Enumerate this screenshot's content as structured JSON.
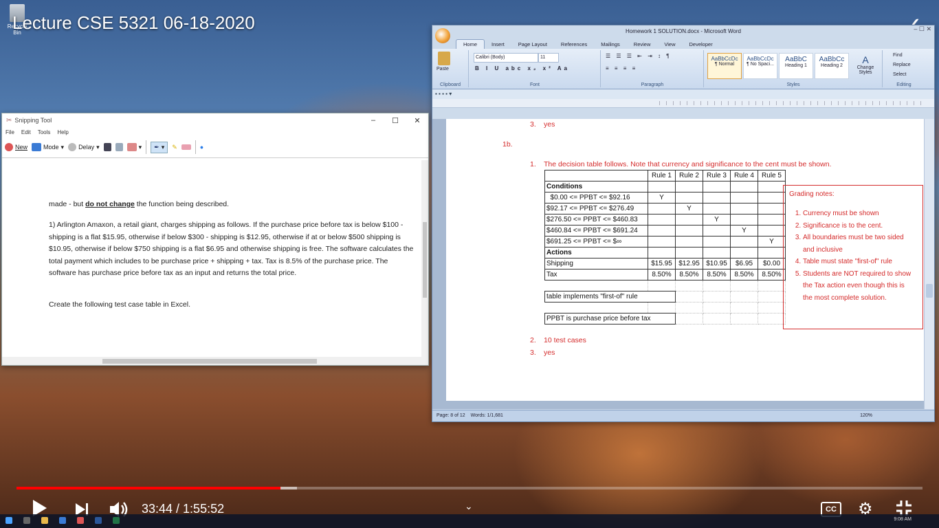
{
  "video": {
    "title": "Lecture CSE 5321 06-18-2020",
    "time": "33:44 / 1:55:52",
    "progress_fraction": 0.2913,
    "cc_label": "CC"
  },
  "desktop": {
    "recycle_label": "Recycle Bin"
  },
  "snip": {
    "title": "Snipping Tool",
    "menu": [
      "File",
      "Edit",
      "Tools",
      "Help"
    ],
    "new_label": "New",
    "mode_label": "Mode",
    "delay_label": "Delay",
    "para0_pre": "made - but ",
    "para0_bold": "do not change",
    "para0_post": " the function being described.",
    "para1": "1)  Arlington Amaxon, a retail giant, charges shipping as follows. If the purchase price before tax is below $100 - shipping is a flat $15.95, otherwise if below $300 - shipping is $12.95, otherwise if at or below $500 shipping is $10.95, otherwise if below $750 shipping is a flat $6.95 and otherwise shipping is free. The software calculates the total payment which includes to be purchase price + shipping + tax. Tax is 8.5% of the purchase price. The software has purchase price before tax as an input and returns the total price.",
    "para2": "Create the following test case table in Excel."
  },
  "word": {
    "title": "Homework 1 SOLUTION.docx - Microsoft Word",
    "tabs": [
      "Home",
      "Insert",
      "Page Layout",
      "References",
      "Mailings",
      "Review",
      "View",
      "Developer"
    ],
    "font_name": "Calibri (Body)",
    "font_size": "11",
    "paste_label": "Paste",
    "groups": [
      "Clipboard",
      "Font",
      "Paragraph",
      "Styles",
      "Editing"
    ],
    "styles": [
      {
        "sample": "AaBbCcDc",
        "name": "¶ Normal"
      },
      {
        "sample": "AaBbCcDc",
        "name": "¶ No Spaci..."
      },
      {
        "sample": "AaBbC",
        "name": "Heading 1"
      },
      {
        "sample": "AaBbCc",
        "name": "Heading 2"
      }
    ],
    "change_styles": "Change Styles",
    "editing": [
      "Find",
      "Replace",
      "Select"
    ],
    "status_page": "Page: 8 of 12",
    "status_words": "Words: 1/1,681",
    "zoom": "120%",
    "doc": {
      "item3a_num": "3.",
      "item3a_text": "yes",
      "section": "1b.",
      "item1_num": "1.",
      "item1_text": "The decision table follows. Note that currency and significance to the cent must be shown.",
      "rule_headers": [
        "Rule 1",
        "Rule 2",
        "Rule 3",
        "Rule 4",
        "Rule 5"
      ],
      "conditions_label": "Conditions",
      "conditions": [
        {
          "label": "  $0.00 <= PPBT <= $92.16",
          "marks": [
            "Y",
            "",
            "",
            "",
            ""
          ]
        },
        {
          "label": "$92.17 <= PPBT <= $276.49",
          "marks": [
            "",
            "Y",
            "",
            "",
            ""
          ]
        },
        {
          "label": "$276.50 <= PPBT <= $460.83",
          "marks": [
            "",
            "",
            "Y",
            "",
            ""
          ]
        },
        {
          "label": "$460.84 <= PPBT <= $691.24",
          "marks": [
            "",
            "",
            "",
            "Y",
            ""
          ]
        },
        {
          "label": "$691.25 <= PPBT <= $∞",
          "marks": [
            "",
            "",
            "",
            "",
            "Y"
          ]
        }
      ],
      "actions_label": "Actions",
      "actions": [
        {
          "label": "Shipping",
          "values": [
            "$15.95",
            "$12.95",
            "$10.95",
            "$6.95",
            "$0.00"
          ]
        },
        {
          "label": "Tax",
          "values": [
            "8.50%",
            "8.50%",
            "8.50%",
            "8.50%",
            "8.50%"
          ]
        }
      ],
      "note1": "table implements \"first-of\" rule",
      "note2": "PPBT is purchase price before tax",
      "item2_num": "2.",
      "item2_text": "10 test cases",
      "item3b_num": "3.",
      "item3b_text": "yes",
      "grading_title": "Grading notes:",
      "grading_items": [
        "Currency must be shown",
        "Significance is to the cent.",
        "All boundaries must be two sided and inclusive",
        "Table must state \"first-of\" rule",
        "Students are NOT required to show the Tax action even though this is the most complete solution."
      ]
    }
  },
  "taskbar": {
    "clock": "9:08 AM"
  },
  "colors": {
    "accent_red": "#d42a2a",
    "progress_red": "#ff0000"
  }
}
